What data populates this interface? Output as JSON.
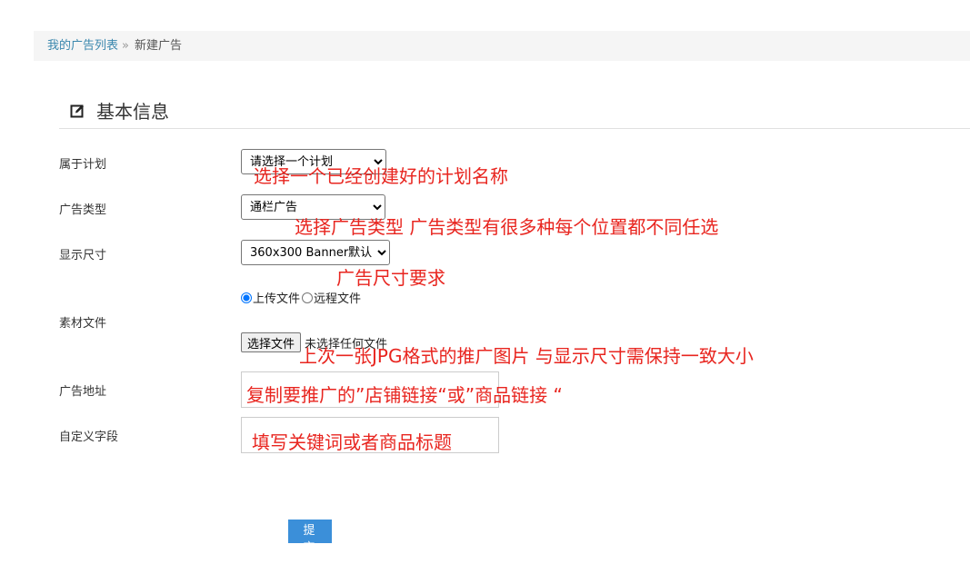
{
  "breadcrumb": {
    "parent": "我的广告列表",
    "separator": "»",
    "current": "新建广告"
  },
  "section": {
    "title": "基本信息",
    "icon": "edit-icon"
  },
  "form": {
    "plan": {
      "label": "属于计划",
      "value": "请选择一个计划"
    },
    "ad_type": {
      "label": "广告类型",
      "value": "通栏广告"
    },
    "size": {
      "label": "显示尺寸",
      "value": "360x300   Banner默认"
    },
    "material": {
      "label": "素材文件",
      "radio_upload": "上传文件",
      "radio_remote": "远程文件",
      "selected": "upload",
      "file_button": "选择文件",
      "file_status": "未选择任何文件"
    },
    "ad_url": {
      "label": "广告地址",
      "value": ""
    },
    "custom_field": {
      "label": "自定义字段",
      "value": ""
    },
    "submit_label": "提 交"
  },
  "annotations": {
    "plan": "选择一个已经创建好的计划名称",
    "ad_type": "选择广告类型 广告类型有很多种每个位置都不同任选",
    "size": "广告尺寸要求",
    "material": "上次一张JPG格式的推广图片 与显示尺寸需保持一致大小",
    "ad_url": "复制要推广的”店铺链接“或”商品链接 “",
    "custom_field": "填写关键词或者商品标题"
  },
  "colors": {
    "annotation": "#e8251f",
    "link": "#3a87ad",
    "submit_bg": "#3b8fd9"
  }
}
